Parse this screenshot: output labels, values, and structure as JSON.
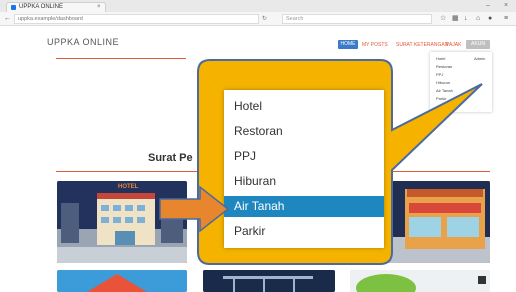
{
  "browser": {
    "tab_title": "UPPKA ONLINE",
    "tab_close": "×",
    "url": "uppka.example/dashboard",
    "search_placeholder": "Search",
    "minimize": "–",
    "close": "×"
  },
  "header": {
    "brand": "UPPKA ONLINE",
    "nav": [
      "HOME",
      "MY POSTS",
      "SURAT KETERANGAN",
      "PAJAK",
      "AKUN"
    ]
  },
  "mini_menu": {
    "items": [
      "Hotel",
      "Restoran",
      "PPJ",
      "Hiburan",
      "Air Tanah",
      "Parkir"
    ],
    "user_label": "Admin"
  },
  "main": {
    "section_title": "Surat Pe",
    "card_sign": "HOTEL"
  },
  "dropdown": {
    "items": [
      "Hotel",
      "Restoran",
      "PPJ",
      "Hiburan",
      "Air Tanah",
      "Parkir"
    ],
    "active_index": 4
  },
  "colors": {
    "callout": "#f5b300",
    "arrow": "#e8862e",
    "accent": "#e05a3a",
    "highlight": "#1f87c0"
  }
}
